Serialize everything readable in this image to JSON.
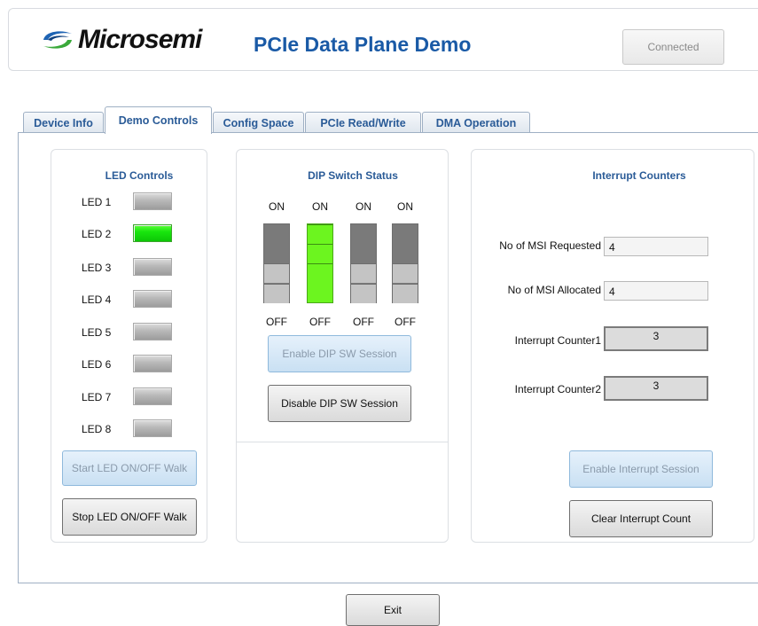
{
  "header": {
    "logo_text": "Microsemi",
    "app_title": "PCIe Data Plane Demo",
    "connection_status": "Connected",
    "brand_colors": {
      "title": "#1a5aa6",
      "logo_blue": "#1e64b4",
      "logo_green": "#3aa93a"
    }
  },
  "tabs": [
    {
      "label": "Device Info",
      "active": false
    },
    {
      "label": "Demo Controls",
      "active": true
    },
    {
      "label": "Config Space",
      "active": false
    },
    {
      "label": "PCIe Read/Write",
      "active": false
    },
    {
      "label": "DMA Operation",
      "active": false
    }
  ],
  "led_controls": {
    "title": "LED Controls",
    "leds": [
      {
        "label": "LED 1",
        "on": false
      },
      {
        "label": "LED 2",
        "on": true
      },
      {
        "label": "LED 3",
        "on": false
      },
      {
        "label": "LED 4",
        "on": false
      },
      {
        "label": "LED 5",
        "on": false
      },
      {
        "label": "LED 6",
        "on": false
      },
      {
        "label": "LED 7",
        "on": false
      },
      {
        "label": "LED 8",
        "on": false
      }
    ],
    "start_button": "Start LED ON/OFF Walk",
    "stop_button": "Stop LED ON/OFF Walk",
    "on_color": "#19e60e"
  },
  "dip_switch": {
    "title": "DIP Switch Status",
    "switches": [
      {
        "on_label": "ON",
        "off_label": "OFF",
        "on": false
      },
      {
        "on_label": "ON",
        "off_label": "OFF",
        "on": true
      },
      {
        "on_label": "ON",
        "off_label": "OFF",
        "on": false
      },
      {
        "on_label": "ON",
        "off_label": "OFF",
        "on": false
      }
    ],
    "enable_button": "Enable DIP SW Session",
    "disable_button": "Disable DIP SW Session",
    "on_color": "#6cf51f"
  },
  "interrupts": {
    "title": "Interrupt Counters",
    "msi_requested_label": "No of MSI Requested",
    "msi_requested_value": "4",
    "msi_allocated_label": "No of MSI Allocated",
    "msi_allocated_value": "4",
    "counter1_label": "Interrupt Counter1",
    "counter1_value": "3",
    "counter2_label": "Interrupt Counter2",
    "counter2_value": "3",
    "enable_button": "Enable Interrupt Session",
    "clear_button": "Clear Interrupt Count"
  },
  "footer": {
    "exit_button": "Exit"
  }
}
